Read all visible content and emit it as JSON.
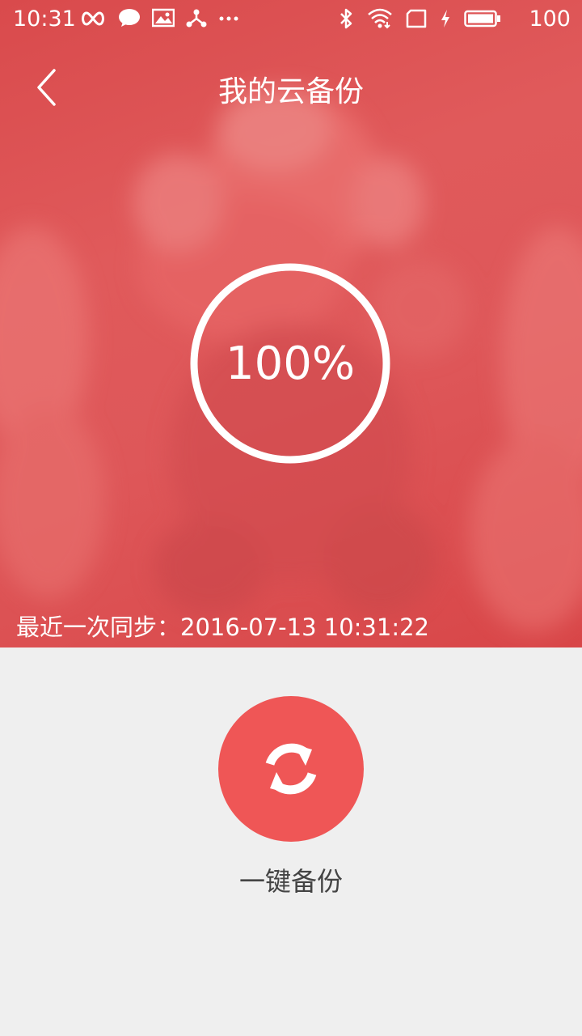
{
  "status_bar": {
    "time": "10:31",
    "battery_level": "100",
    "left_icons": [
      "infinity-icon",
      "chat-icon",
      "image-icon",
      "share-hub-icon",
      "more-dots-icon"
    ],
    "right_icons": [
      "bluetooth-icon",
      "wifi-icon",
      "sim-icon",
      "charging-icon",
      "battery-icon"
    ]
  },
  "header": {
    "title": "我的云备份",
    "back_icon": "chevron-left-icon"
  },
  "progress": {
    "percent_label": "100%",
    "percent_value": 100
  },
  "last_sync": {
    "text": "最近一次同步：2016-07-13 10:31:22"
  },
  "actions": {
    "backup_label": "一键备份",
    "backup_icon": "sync-arrows-icon"
  },
  "colors": {
    "hero_red": "#de5759",
    "button_red": "#ef5656",
    "page_bg": "#efefef",
    "label_text": "#444444"
  }
}
